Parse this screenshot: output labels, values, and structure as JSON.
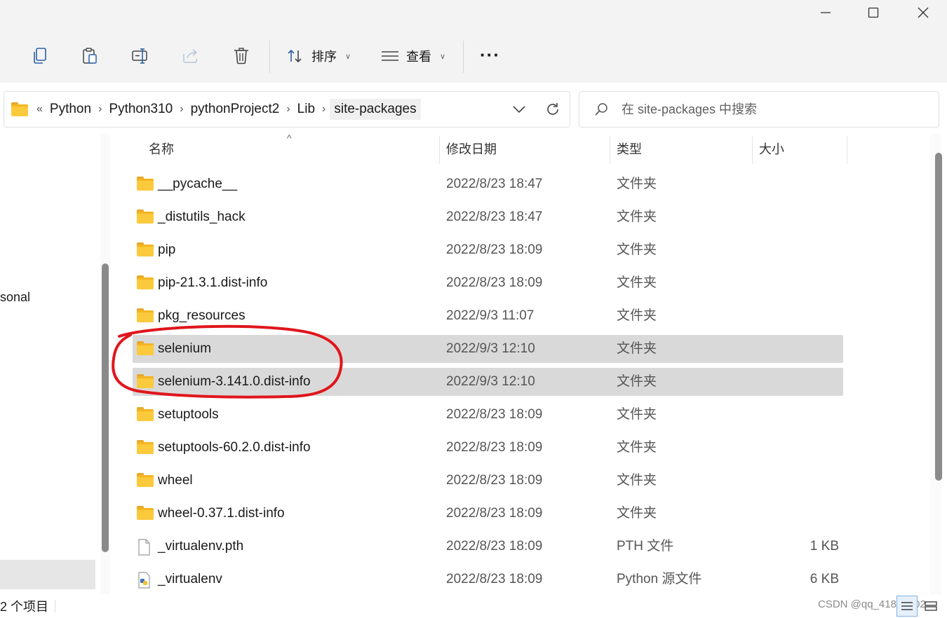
{
  "window": {
    "minimize_glyph": "—",
    "maximize_glyph": "☐",
    "close_glyph": "✕"
  },
  "toolbar": {
    "copy_icon": "copy-icon",
    "paste_icon": "paste-icon",
    "rename_icon": "rename-icon",
    "share_icon": "share-icon",
    "delete_icon": "delete-icon",
    "sort_label": "排序",
    "view_label": "查看",
    "more_label": "···"
  },
  "address": {
    "overflow": "«",
    "crumbs": [
      "Python",
      "Python310",
      "pythonProject2",
      "Lib",
      "site-packages"
    ]
  },
  "search": {
    "placeholder": "在 site-packages 中搜索"
  },
  "nav": {
    "partial_label": "sonal"
  },
  "columns": {
    "name": "名称",
    "date": "修改日期",
    "type": "类型",
    "size": "大小"
  },
  "files": [
    {
      "name": "__pycache__",
      "date": "2022/8/23 18:47",
      "type": "文件夹",
      "size": "",
      "icon": "folder-icon",
      "selected": false
    },
    {
      "name": "_distutils_hack",
      "date": "2022/8/23 18:47",
      "type": "文件夹",
      "size": "",
      "icon": "folder-icon",
      "selected": false
    },
    {
      "name": "pip",
      "date": "2022/8/23 18:09",
      "type": "文件夹",
      "size": "",
      "icon": "folder-icon",
      "selected": false
    },
    {
      "name": "pip-21.3.1.dist-info",
      "date": "2022/8/23 18:09",
      "type": "文件夹",
      "size": "",
      "icon": "folder-icon",
      "selected": false
    },
    {
      "name": "pkg_resources",
      "date": "2022/9/3 11:07",
      "type": "文件夹",
      "size": "",
      "icon": "folder-icon",
      "selected": false
    },
    {
      "name": "selenium",
      "date": "2022/9/3 12:10",
      "type": "文件夹",
      "size": "",
      "icon": "folder-icon",
      "selected": true
    },
    {
      "name": "selenium-3.141.0.dist-info",
      "date": "2022/9/3 12:10",
      "type": "文件夹",
      "size": "",
      "icon": "folder-icon",
      "selected": true
    },
    {
      "name": "setuptools",
      "date": "2022/8/23 18:09",
      "type": "文件夹",
      "size": "",
      "icon": "folder-icon",
      "selected": false
    },
    {
      "name": "setuptools-60.2.0.dist-info",
      "date": "2022/8/23 18:09",
      "type": "文件夹",
      "size": "",
      "icon": "folder-icon",
      "selected": false
    },
    {
      "name": "wheel",
      "date": "2022/8/23 18:09",
      "type": "文件夹",
      "size": "",
      "icon": "folder-icon",
      "selected": false
    },
    {
      "name": "wheel-0.37.1.dist-info",
      "date": "2022/8/23 18:09",
      "type": "文件夹",
      "size": "",
      "icon": "folder-icon",
      "selected": false
    },
    {
      "name": "_virtualenv.pth",
      "date": "2022/8/23 18:09",
      "type": "PTH 文件",
      "size": "1 KB",
      "icon": "file-icon",
      "selected": false
    },
    {
      "name": "_virtualenv",
      "date": "2022/8/23 18:09",
      "type": "Python 源文件",
      "size": "6 KB",
      "icon": "python-file-icon",
      "selected": false
    }
  ],
  "status": {
    "item_count": "2 个项目",
    "watermark": "CSDN @qq_41854402"
  },
  "colors": {
    "selection": "#d9d9d9",
    "annotation": "#e0161c",
    "folder": "#fbc93c"
  }
}
